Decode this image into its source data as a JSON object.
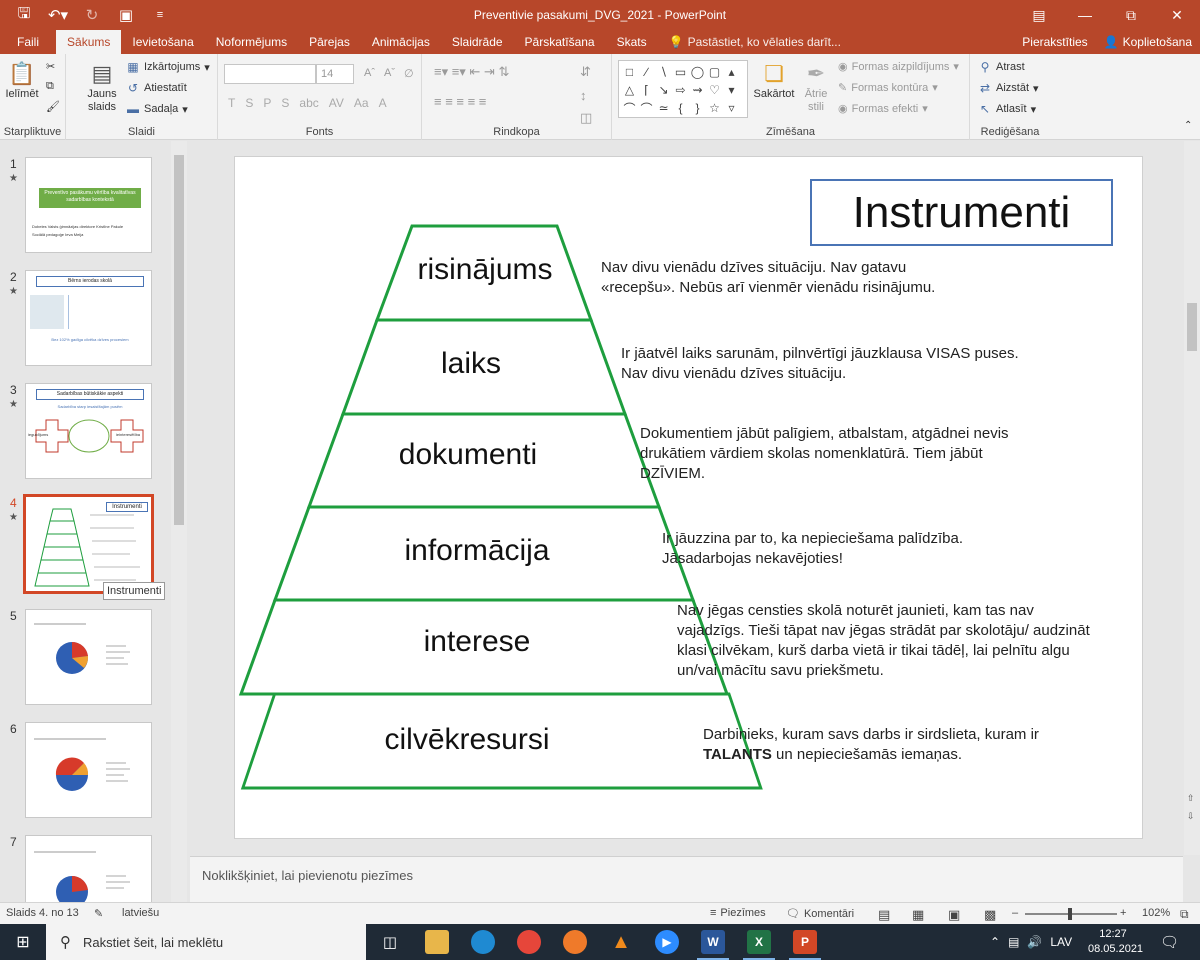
{
  "window": {
    "title": "Preventivie pasakumi_DVG_2021 - PowerPoint",
    "controls": [
      "ribbon-display",
      "minimize",
      "restore",
      "close"
    ]
  },
  "quick_access": {
    "save_icon": "floppy-disk-icon",
    "undo_icon": "undo-icon",
    "redo_icon": "redo-icon",
    "present_icon": "present-from-start-icon",
    "customize_icon": "customize-dropdown-icon"
  },
  "tabs": [
    "Faili",
    "Sākums",
    "Ievietošana",
    "Noformējums",
    "Pārejas",
    "Animācijas",
    "Slaidrāde",
    "Pārskatīšana",
    "Skats"
  ],
  "active_tab": "Sākums",
  "tell_me": "Pastāstiet, ko vēlaties darīt...",
  "account": {
    "sign_in": "Pierakstīties",
    "share": "Koplietošana"
  },
  "ribbon": {
    "clipboard": {
      "label": "Starpliktuve",
      "paste": "Ielīmēt"
    },
    "slides": {
      "label": "Slaidi",
      "new_slide": "Jauns slaids",
      "layout": "Izkārtojums",
      "reset": "Atiestatīt",
      "section": "Sadaļa"
    },
    "font": {
      "label": "Fonts",
      "font_size": "14",
      "format_buttons": [
        "T",
        "S",
        "P",
        "S",
        "abc",
        "AV",
        "Aa",
        "A"
      ]
    },
    "paragraph": {
      "label": "Rindkopa"
    },
    "drawing": {
      "label": "Zīmēšana",
      "arrange": "Sakārtot",
      "quick_styles": "Ātrie stili",
      "shape_fill": "Formas aizpildījums",
      "shape_outline": "Formas kontūra",
      "shape_effects": "Formas efekti"
    },
    "editing": {
      "label": "Rediģēšana",
      "find": "Atrast",
      "replace": "Aizstāt",
      "select": "Atlasīt"
    }
  },
  "thumbnails": [
    {
      "num": "1",
      "title": "Preventīvo pasākumu vērtība kvalitatīvas sadarbības kontekstā",
      "sub1": "Dobeles Valsts ģimnāzijas direktore Kristīne Pakule",
      "sub2": "Sociālā pedagoģe Ieva Meija"
    },
    {
      "num": "2",
      "title": "Bērns ierodas skolā",
      "footer": "Bez 102% gadīga cilvēka dzīves procesiem"
    },
    {
      "num": "3",
      "title": "Sadarbības būtiskākie aspekti",
      "sub1": "Sadarbība starp iesaistītajām pusēm",
      "left": "ieguldījums",
      "right": "ieinteresētība"
    },
    {
      "num": "4",
      "title": "Instrumenti",
      "selected": true
    },
    {
      "num": "5"
    },
    {
      "num": "6"
    },
    {
      "num": "7"
    }
  ],
  "tooltip": "Instrumenti",
  "slide": {
    "title": "Instrumenti",
    "levels": [
      {
        "label": "risinājums",
        "desc": "Nav divu vienādu dzīves situāciju. Nav gatavu «recepšu». Nebūs arī vienmēr vienādu risinājumu."
      },
      {
        "label": "laiks",
        "desc": "Ir jāatvēl laiks sarunām, pilnvērtīgi jāuzklausa VISAS puses. Nav divu vienādu dzīves situāciju."
      },
      {
        "label": "dokumenti",
        "desc": "Dokumentiem jābūt palīgiem, atbalstam, atgādnei nevis drukātiem vārdiem skolas nomenklatūrā. Tiem jābūt DZĪVIEM."
      },
      {
        "label": "informācija",
        "desc": "Ir jāuzzina par to, ka nepieciešama palīdzība. Jāsadarbojas nekavējoties!"
      },
      {
        "label": "interese",
        "desc": "Nav jēgas censties skolā noturēt jaunieti, kam tas nav vajadzīgs. Tieši tāpat nav jēgas strādāt par skolotāju/ audzināt klasi cilvēkam, kurš darba vietā ir tikai tādēļ, lai pelnītu algu un/vai mācītu savu priekšmetu."
      },
      {
        "label": "cilvēkresursi",
        "desc_pre": "Darbinieks, kuram savs darbs ir sirdslieta, kuram ir ",
        "desc_bold": "TALANTS",
        "desc_post": " un nepieciešamās iemaņas."
      }
    ],
    "outline_color": "#1e9e3e"
  },
  "notes_placeholder": "Noklikšķiniet, lai pievienotu piezīmes",
  "status": {
    "slide_count": "Slaids 4. no 13",
    "language": "latviešu",
    "notes": "Piezīmes",
    "comments": "Komentāri",
    "zoom": "102%"
  },
  "taskbar": {
    "search": "Rakstiet šeit, lai meklētu",
    "apps": [
      "task-view",
      "file-explorer",
      "edge",
      "chrome",
      "firefox",
      "vlc",
      "zoom",
      "word",
      "excel",
      "powerpoint"
    ],
    "language": "LAV",
    "time": "12:27",
    "date": "08.05.2021"
  }
}
